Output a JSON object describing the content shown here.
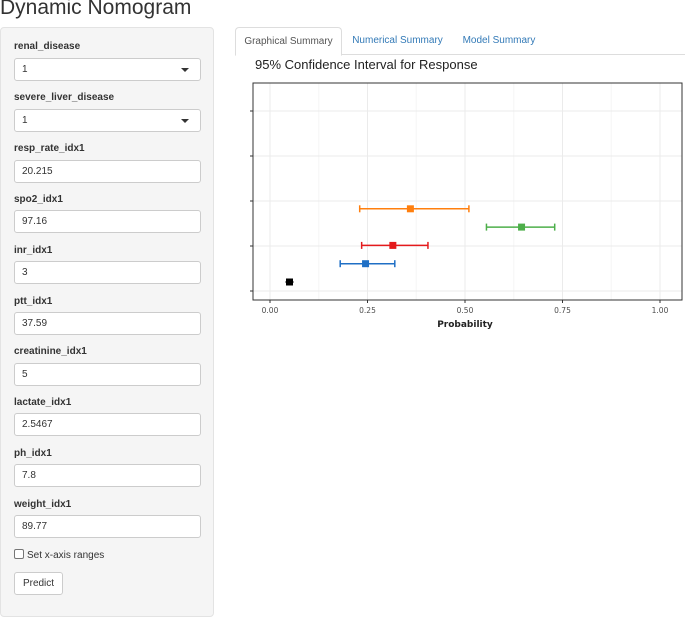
{
  "app": {
    "title": "Dynamic Nomogram"
  },
  "sidebar": {
    "fields": [
      {
        "label": "renal_disease",
        "kind": "select",
        "value": "1"
      },
      {
        "label": "severe_liver_disease",
        "kind": "select",
        "value": "1"
      },
      {
        "label": "resp_rate_idx1",
        "kind": "input",
        "value": "20.215"
      },
      {
        "label": "spo2_idx1",
        "kind": "input",
        "value": "97.16"
      },
      {
        "label": "inr_idx1",
        "kind": "input",
        "value": "3"
      },
      {
        "label": "ptt_idx1",
        "kind": "input",
        "value": "37.59"
      },
      {
        "label": "creatinine_idx1",
        "kind": "input",
        "value": "5"
      },
      {
        "label": "lactate_idx1",
        "kind": "input",
        "value": "2.5467"
      },
      {
        "label": "ph_idx1",
        "kind": "input",
        "value": "7.8"
      },
      {
        "label": "weight_idx1",
        "kind": "input",
        "value": "89.77"
      }
    ],
    "checkbox_label": "Set x-axis ranges",
    "predict_label": "Predict"
  },
  "tabs": [
    {
      "label": "Graphical Summary",
      "active": true
    },
    {
      "label": "Numerical Summary",
      "active": false
    },
    {
      "label": "Model Summary",
      "active": false
    }
  ],
  "chart_data": {
    "type": "scatter",
    "title": "95% Confidence Interval for Response",
    "xlabel": "Probability",
    "ylabel": "",
    "xlim": [
      0,
      1
    ],
    "xticks": [
      "0.00",
      "0.25",
      "0.50",
      "0.75",
      "1.00"
    ],
    "grid": true,
    "points": [
      {
        "estimate": 0.05,
        "lower": 0.05,
        "upper": 0.05,
        "color": "#000000"
      },
      {
        "estimate": 0.245,
        "lower": 0.18,
        "upper": 0.32,
        "color": "#1f6fc5"
      },
      {
        "estimate": 0.315,
        "lower": 0.235,
        "upper": 0.405,
        "color": "#e41a1c"
      },
      {
        "estimate": 0.645,
        "lower": 0.555,
        "upper": 0.73,
        "color": "#4daf4a"
      },
      {
        "estimate": 0.36,
        "lower": 0.23,
        "upper": 0.51,
        "color": "#ff7f0e"
      }
    ]
  }
}
